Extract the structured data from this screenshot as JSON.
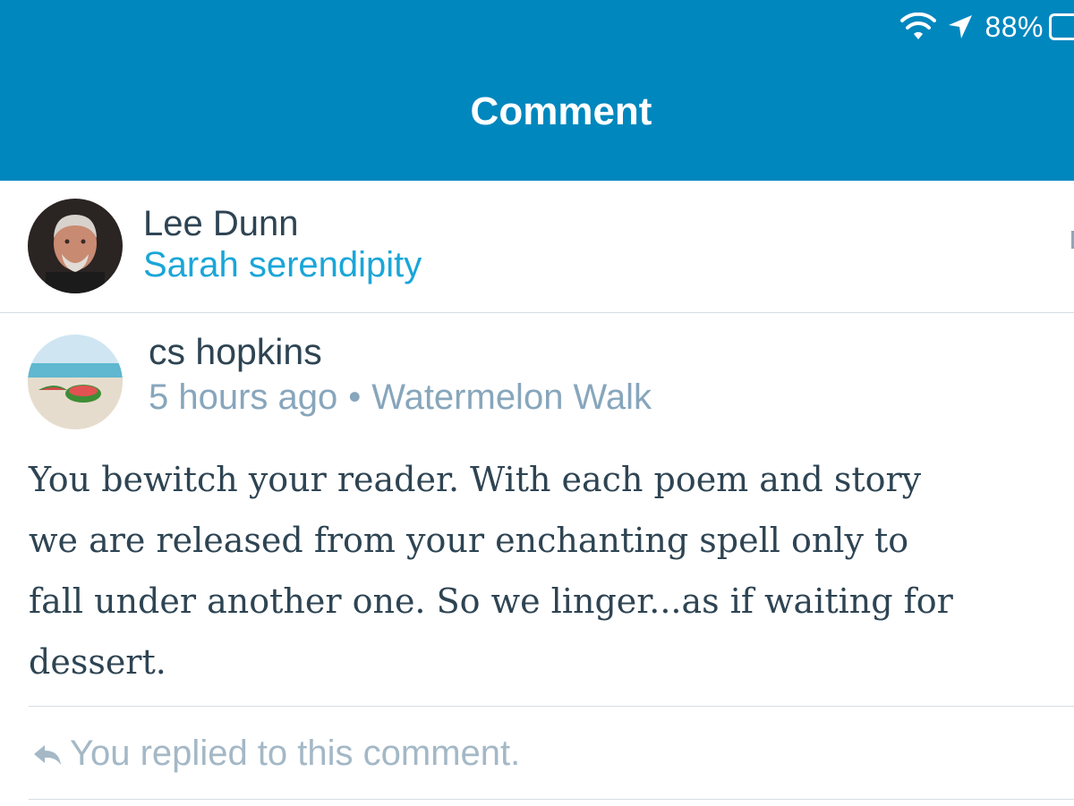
{
  "status_bar": {
    "battery_percent": "88%",
    "icons": [
      "wifi-icon",
      "location-arrow-icon",
      "battery-icon"
    ]
  },
  "header": {
    "title": "Comment",
    "background_color": "#0087be"
  },
  "post": {
    "author": "Lee Dunn",
    "site": "Sarah serendipity"
  },
  "comment": {
    "author": "cs hopkins",
    "time": "5 hours ago",
    "separator": "•",
    "post_title": "Watermelon Walk",
    "body": "You bewitch your reader. With each poem and story\nwe are released from your enchanting spell only to\nfall under another one. So we linger...as if waiting for\ndessert.",
    "reply_status": "You replied to this comment."
  },
  "colors": {
    "text_primary": "#2e4453",
    "link": "#1aa6d8",
    "meta": "#87a6bc",
    "divider": "#d4dde4"
  }
}
